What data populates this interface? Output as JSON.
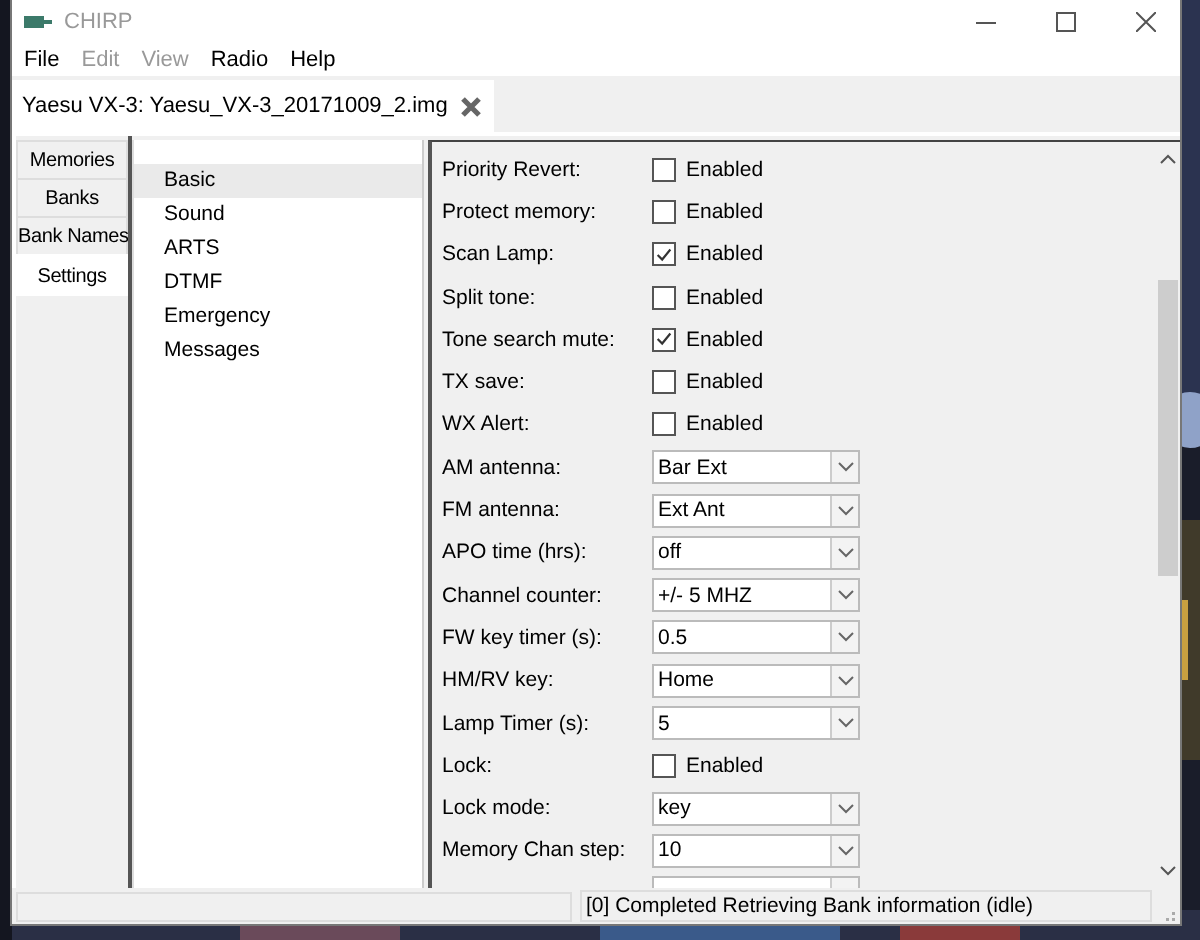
{
  "window": {
    "title": "CHIRP"
  },
  "menu": [
    {
      "label": "File",
      "disabled": false
    },
    {
      "label": "Edit",
      "disabled": true
    },
    {
      "label": "View",
      "disabled": true
    },
    {
      "label": "Radio",
      "disabled": false
    },
    {
      "label": "Help",
      "disabled": false
    }
  ],
  "document_tab": {
    "label": "Yaesu VX-3: Yaesu_VX-3_20171009_2.img"
  },
  "side_tabs": [
    {
      "label": "Memories",
      "selected": false
    },
    {
      "label": "Banks",
      "selected": false
    },
    {
      "label": "Bank Names",
      "selected": false
    },
    {
      "label": "Settings",
      "selected": true
    }
  ],
  "groups": [
    {
      "label": "Basic",
      "selected": true
    },
    {
      "label": "Sound",
      "selected": false
    },
    {
      "label": "ARTS",
      "selected": false
    },
    {
      "label": "DTMF",
      "selected": false
    },
    {
      "label": "Emergency",
      "selected": false
    },
    {
      "label": "Messages",
      "selected": false
    }
  ],
  "settings": [
    {
      "kind": "checkbox",
      "label": "Priority Revert:",
      "text": "Enabled",
      "checked": false
    },
    {
      "kind": "checkbox",
      "label": "Protect memory:",
      "text": "Enabled",
      "checked": false
    },
    {
      "kind": "checkbox",
      "label": "Scan Lamp:",
      "text": "Enabled",
      "checked": true
    },
    {
      "kind": "checkbox",
      "label": "Split tone:",
      "text": "Enabled",
      "checked": false
    },
    {
      "kind": "checkbox",
      "label": "Tone search mute:",
      "text": "Enabled",
      "checked": true
    },
    {
      "kind": "checkbox",
      "label": "TX save:",
      "text": "Enabled",
      "checked": false
    },
    {
      "kind": "checkbox",
      "label": "WX Alert:",
      "text": "Enabled",
      "checked": false
    },
    {
      "kind": "select",
      "label": "AM antenna:",
      "value": "Bar Ext"
    },
    {
      "kind": "select",
      "label": "FM antenna:",
      "value": "Ext Ant"
    },
    {
      "kind": "select",
      "label": "APO time (hrs):",
      "value": "off"
    },
    {
      "kind": "select",
      "label": "Channel counter:",
      "value": "+/- 5 MHZ"
    },
    {
      "kind": "select",
      "label": "FW key timer (s):",
      "value": "0.5"
    },
    {
      "kind": "select",
      "label": "HM/RV key:",
      "value": "Home"
    },
    {
      "kind": "select",
      "label": "Lamp Timer (s):",
      "value": "5"
    },
    {
      "kind": "checkbox",
      "label": "Lock:",
      "text": "Enabled",
      "checked": false
    },
    {
      "kind": "select",
      "label": "Lock mode:",
      "value": "key"
    },
    {
      "kind": "select",
      "label": "Memory Chan step:",
      "value": "10"
    },
    {
      "kind": "select"
    }
  ],
  "status_bar": {
    "message": "[0] Completed Retrieving Bank information (idle)"
  }
}
